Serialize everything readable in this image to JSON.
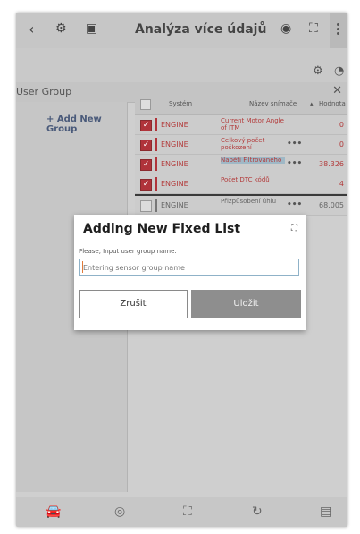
{
  "header": {
    "back_icon": "back-chevron",
    "title": "Analýza více údajů",
    "icons": [
      "car-gear-icon",
      "car-battery-icon",
      "record-icon",
      "expand-icon",
      "more-icon"
    ]
  },
  "user_group": {
    "label": "User Group",
    "add_label": "+ Add New Group"
  },
  "table": {
    "headers": [
      "Systém",
      "Název snímače",
      "Hodnota"
    ],
    "rows": [
      {
        "system": "ENGINE",
        "name": "Current Motor Angle of ITM",
        "value": "0",
        "checked": true,
        "active": true,
        "dots": false,
        "highlight": false
      },
      {
        "system": "ENGINE",
        "name": "Celkový počet poškození",
        "value": "0",
        "checked": true,
        "active": true,
        "dots": true,
        "highlight": false
      },
      {
        "system": "ENGINE",
        "name": "Napětí Filtrovaného",
        "value": "38.326",
        "checked": true,
        "active": true,
        "dots": true,
        "highlight": true
      },
      {
        "system": "ENGINE",
        "name": "Počet DTC kódů",
        "value": "4",
        "checked": true,
        "active": true,
        "dots": false,
        "highlight": false
      },
      {
        "system": "ENGINE",
        "name": "Přizpůsobení úhlu",
        "value": "68.005",
        "checked": false,
        "active": false,
        "dots": true,
        "highlight": false
      }
    ]
  },
  "dialog": {
    "title": "Adding New Fixed List",
    "prompt": "Please, Input user group name.",
    "input_placeholder": "Entering sensor group name",
    "input_value": "",
    "cancel_label": "Zrušit",
    "save_label": "Uložit"
  },
  "colors": {
    "accent_red": "#b33c3c",
    "save_button": "#8e8e8e",
    "overlay": "#cfcfcf"
  }
}
